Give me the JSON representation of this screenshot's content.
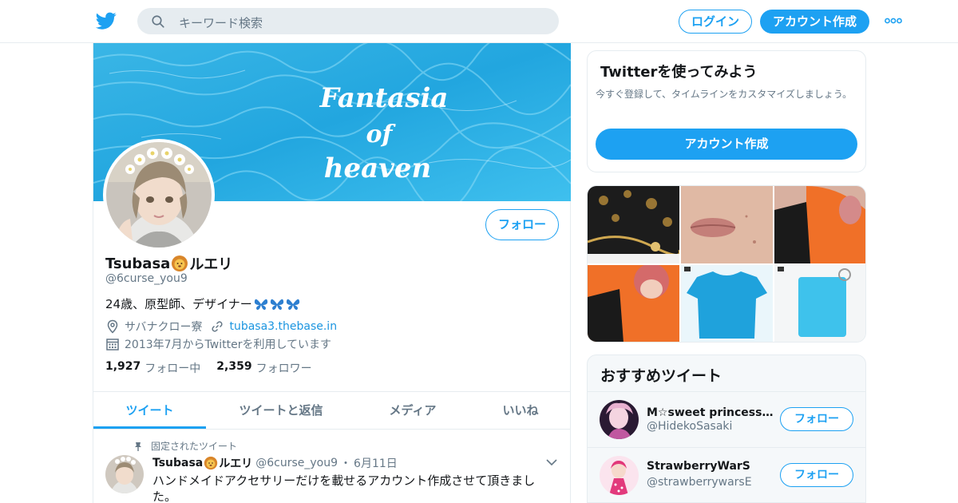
{
  "header": {
    "search_placeholder": "キーワード検索",
    "login_label": "ログイン",
    "signup_label": "アカウント作成",
    "brand_color": "#1da1f2"
  },
  "profile": {
    "banner_text": [
      "Fantasia",
      "of",
      "heaven"
    ],
    "follow_label": "フォロー",
    "name_prefix": "Tsubasa",
    "name_suffix": "ルエリ",
    "handle": "@6curse_you9",
    "bio": "24歳、原型師、デザイナー",
    "location": "サバナクロー寮",
    "website": "tubasa3.thebase.in",
    "joined": "2013年7月からTwitterを利用しています",
    "following_count": "1,927",
    "following_label": "フォロー中",
    "followers_count": "2,359",
    "followers_label": "フォロワー"
  },
  "tabs": [
    {
      "label": "ツイート",
      "active": true
    },
    {
      "label": "ツイートと返信",
      "active": false
    },
    {
      "label": "メディア",
      "active": false
    },
    {
      "label": "いいね",
      "active": false
    }
  ],
  "pinned_tweet": {
    "pinned_label": "固定されたツイート",
    "name_prefix": "Tsubasa",
    "name_suffix": "ルエリ",
    "handle": "@6curse_you9",
    "separator": "・",
    "date": "6月11日",
    "text": "ハンドメイドアクセサリーだけを載せるアカウント作成させて頂きました。"
  },
  "signup_card": {
    "title": "Twitterを使ってみよう",
    "subtitle": "今すぐ登録して、タイムラインをカスタマイズしましょう。",
    "button_label": "アカウント作成"
  },
  "recommended": {
    "title": "おすすめツイート",
    "items": [
      {
        "name": "M☆sweet princessプ…",
        "handle": "@HidekoSasaki",
        "button": "フォロー"
      },
      {
        "name": "StrawberryWarS",
        "handle": "@strawberrywarsE",
        "button": "フォロー"
      }
    ]
  },
  "icons": [
    "twitter-logo-icon",
    "search-icon",
    "more-dots-icon",
    "location-icon",
    "link-icon",
    "calendar-icon",
    "pin-icon",
    "chevron-down-icon",
    "lion-emoji-icon",
    "butterfly-emoji-icon"
  ]
}
